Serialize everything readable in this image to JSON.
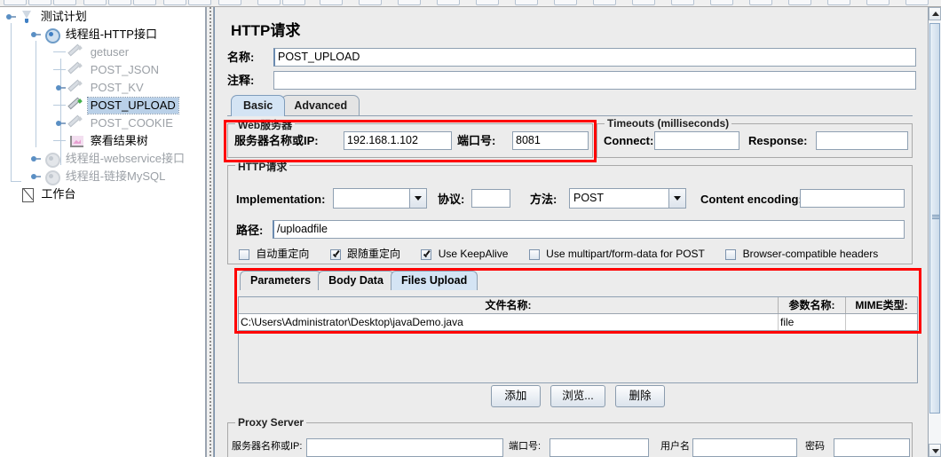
{
  "window": {
    "panel_title": "HTTP请求"
  },
  "tree": {
    "items": [
      {
        "label": "测试计划",
        "icon": "test-plan-icon",
        "depth": 0,
        "state": "enabled",
        "selected": false,
        "handle": false
      },
      {
        "label": "线程组-HTTP接口",
        "icon": "thread-group-icon",
        "depth": 1,
        "state": "enabled",
        "selected": false,
        "handle": true
      },
      {
        "label": "getuser",
        "icon": "http-sampler-icon",
        "depth": 2,
        "state": "disabled",
        "selected": false,
        "handle": false
      },
      {
        "label": "POST_JSON",
        "icon": "http-sampler-icon",
        "depth": 2,
        "state": "disabled",
        "selected": false,
        "handle": false
      },
      {
        "label": "POST_KV",
        "icon": "http-sampler-icon",
        "depth": 2,
        "state": "disabled",
        "selected": false,
        "handle": true
      },
      {
        "label": "POST_UPLOAD",
        "icon": "http-sampler-icon",
        "depth": 2,
        "state": "enabled",
        "selected": true,
        "handle": false
      },
      {
        "label": "POST_COOKIE",
        "icon": "http-sampler-icon",
        "depth": 2,
        "state": "disabled",
        "selected": false,
        "handle": true
      },
      {
        "label": "察看结果树",
        "icon": "view-results-tree-icon",
        "depth": 2,
        "state": "enabled",
        "selected": false,
        "handle": false
      },
      {
        "label": "线程组-webservice接口",
        "icon": "thread-group-icon",
        "depth": 1,
        "state": "disabled",
        "selected": false,
        "handle": true
      },
      {
        "label": "线程组-链接MySQL",
        "icon": "thread-group-icon",
        "depth": 1,
        "state": "disabled",
        "selected": false,
        "handle": true
      },
      {
        "label": "工作台",
        "icon": "workbench-icon",
        "depth": 0,
        "state": "enabled",
        "selected": false,
        "handle": false
      }
    ]
  },
  "form": {
    "name_label": "名称:",
    "name_value": "POST_UPLOAD",
    "comment_label": "注释:",
    "comment_value": ""
  },
  "main_tabs": [
    {
      "label": "Basic",
      "active": true
    },
    {
      "label": "Advanced",
      "active": false
    }
  ],
  "web_server": {
    "legend": "Web服务器",
    "server_label": "服务器名称或IP:",
    "server_value": "192.168.1.102",
    "port_label": "端口号:",
    "port_value": "8081"
  },
  "timeouts": {
    "legend": "Timeouts (milliseconds)",
    "connect_label": "Connect:",
    "connect_value": "",
    "response_label": "Response:",
    "response_value": ""
  },
  "http_request": {
    "legend": "HTTP请求",
    "implementation_label": "Implementation:",
    "implementation_value": "",
    "protocol_label": "协议:",
    "protocol_value": "",
    "method_label": "方法:",
    "method_value": "POST",
    "content_encoding_label": "Content encoding:",
    "content_encoding_value": "",
    "path_label": "路径:",
    "path_value": "/uploadfile",
    "checkboxes": [
      {
        "label": "自动重定向",
        "checked": false
      },
      {
        "label": "跟随重定向",
        "checked": true
      },
      {
        "label": "Use KeepAlive",
        "checked": true
      },
      {
        "label": "Use multipart/form-data for POST",
        "checked": false
      },
      {
        "label": "Browser-compatible headers",
        "checked": false
      }
    ]
  },
  "sub_tabs": [
    {
      "label": "Parameters",
      "active": false
    },
    {
      "label": "Body Data",
      "active": false
    },
    {
      "label": "Files Upload",
      "active": true
    }
  ],
  "files_table": {
    "columns": [
      "文件名称:",
      "参数名称:",
      "MIME类型:"
    ],
    "rows": [
      [
        "C:\\Users\\Administrator\\Desktop\\javaDemo.java",
        "file",
        ""
      ]
    ]
  },
  "table_buttons": [
    {
      "label": "添加"
    },
    {
      "label": "浏览..."
    },
    {
      "label": "删除"
    }
  ],
  "proxy_server": {
    "legend": "Proxy Server",
    "server_label": "服务器名称或IP:",
    "server_value": "",
    "port_label": "端口号:",
    "port_value": "",
    "username_label": "用户名",
    "username_value": "",
    "password_label": "密码",
    "password_value": ""
  },
  "highlights": {
    "color": "#ff0000",
    "boxes": [
      {
        "name": "web-server-highlight"
      },
      {
        "name": "files-upload-highlight"
      }
    ]
  },
  "colors": {
    "selection": "#b9d0e8",
    "active_tab": "#d4e4f4",
    "panel_bg": "#ececec",
    "border": "#8fa0b2"
  }
}
